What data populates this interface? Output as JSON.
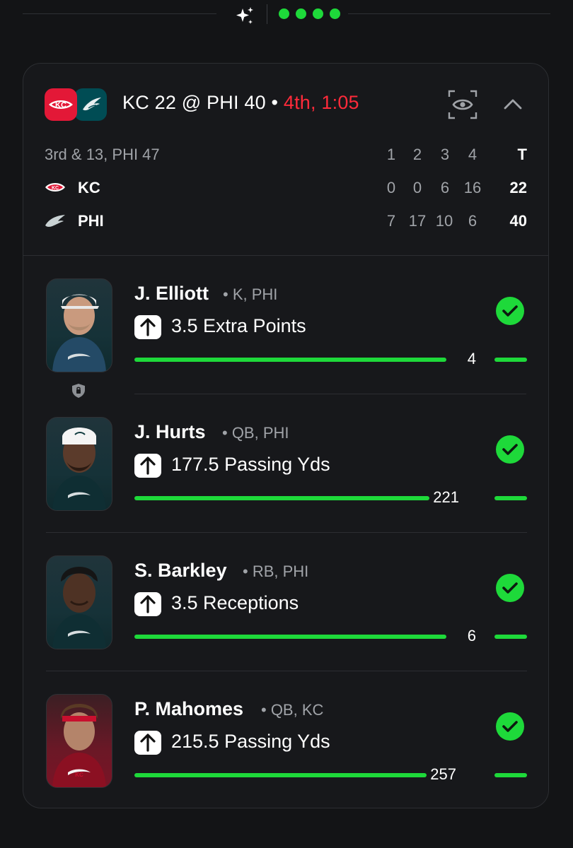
{
  "header": {
    "sparkle_icon": "sparkle-icon",
    "page_dots": 4,
    "accent_color": "#1ed93a"
  },
  "game": {
    "title": "KC 22 @ PHI 40 •",
    "clock": "4th, 1:05",
    "clock_color": "#ff2a3a",
    "situation": "3rd & 13, PHI 47",
    "quarters": [
      "1",
      "2",
      "3",
      "4"
    ],
    "total_label": "T",
    "teams": [
      {
        "abbr": "KC",
        "scores": [
          "0",
          "0",
          "6",
          "16"
        ],
        "total": "22",
        "color": "#e31837"
      },
      {
        "abbr": "PHI",
        "scores": [
          "7",
          "17",
          "10",
          "6"
        ],
        "total": "40",
        "color": "#004c54"
      }
    ]
  },
  "props": [
    {
      "name": "J. Elliott",
      "meta": "• K, PHI",
      "line": "3.5 Extra Points",
      "actual": "4",
      "progress": 0.94,
      "team": "phi",
      "status": "hit"
    },
    {
      "name": "J. Hurts",
      "meta": "• QB, PHI",
      "line": "177.5 Passing Yds",
      "actual": "221",
      "progress": 0.89,
      "team": "phi",
      "status": "hit"
    },
    {
      "name": "S. Barkley",
      "meta": "• RB, PHI",
      "line": "3.5 Receptions",
      "actual": "6",
      "progress": 0.94,
      "team": "phi",
      "status": "hit"
    },
    {
      "name": "P. Mahomes",
      "meta": "• QB, KC",
      "line": "215.5 Passing Yds",
      "actual": "257",
      "progress": 0.88,
      "team": "kc",
      "status": "hit"
    }
  ]
}
